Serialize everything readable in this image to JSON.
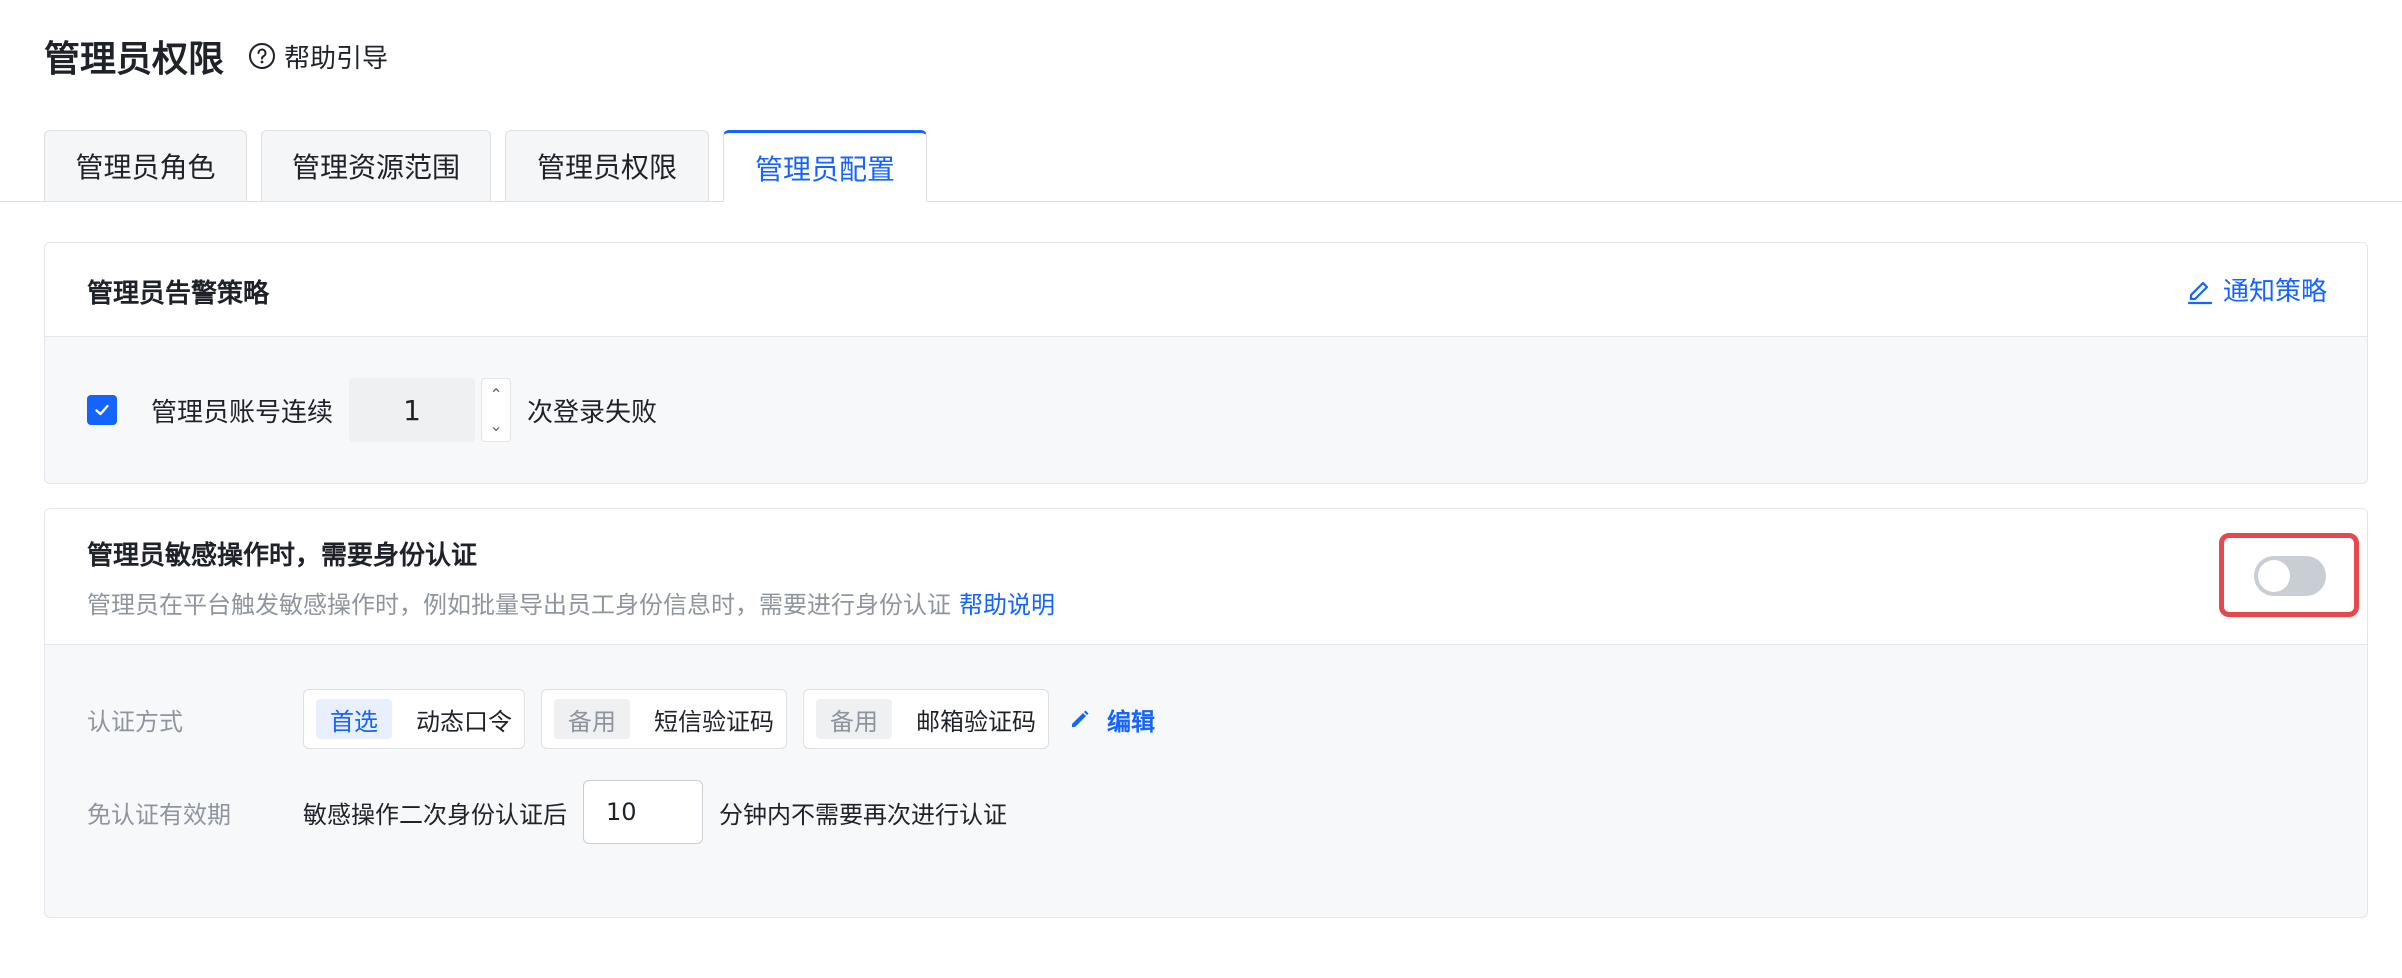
{
  "header": {
    "title": "管理员权限",
    "help_label": "帮助引导"
  },
  "tabs": [
    {
      "label": "管理员角色"
    },
    {
      "label": "管理资源范围"
    },
    {
      "label": "管理员权限"
    },
    {
      "label": "管理员配置",
      "active": true
    }
  ],
  "alert_card": {
    "title": "管理员告警策略",
    "notify_label": "通知策略",
    "rule": {
      "checked": true,
      "prefix": "管理员账号连续",
      "count": "1",
      "suffix": "次登录失败"
    }
  },
  "auth_card": {
    "title": "管理员敏感操作时，需要身份认证",
    "description": "管理员在平台触发敏感操作时，例如批量导出员工身份信息时，需要进行身份认证",
    "help_link": "帮助说明",
    "toggle_on": false,
    "methods_label": "认证方式",
    "methods": [
      {
        "tag": "首选",
        "name": "动态口令",
        "primary": true
      },
      {
        "tag": "备用",
        "name": "短信验证码",
        "primary": false
      },
      {
        "tag": "备用",
        "name": "邮箱验证码",
        "primary": false
      }
    ],
    "edit_label": "编辑",
    "validity_label": "免认证有效期",
    "validity_prefix": "敏感操作二次身份认证后",
    "validity_minutes": "10",
    "validity_suffix": "分钟内不需要再次进行认证"
  },
  "colors": {
    "accent": "#1664ff",
    "highlight": "#e5484d",
    "toggle_off": "#c9cdd4"
  },
  "icons": {
    "help": "question-circle-icon",
    "notify": "edit-underline-icon",
    "checkbox": "check-icon",
    "edit": "pencil-icon"
  }
}
